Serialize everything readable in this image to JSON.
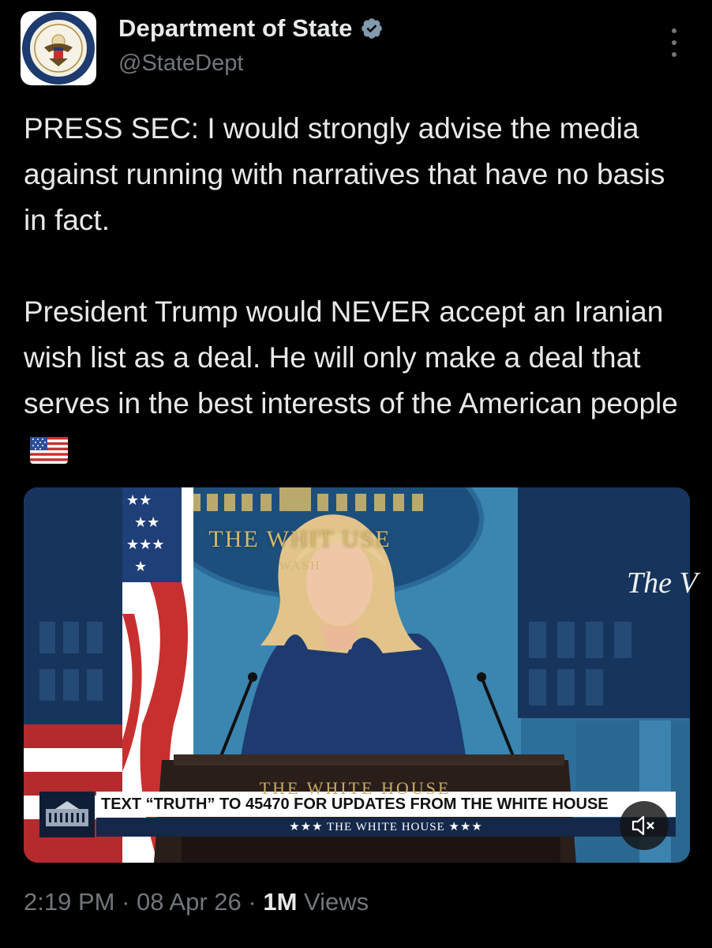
{
  "author": {
    "display_name": "Department of State",
    "handle": "@StateDept",
    "verified": true,
    "avatar_icon": "department-of-state-seal-icon",
    "avatar_text": "DEPARTMENT OF STATE · UNITED STATES OF AMERICA"
  },
  "tweet": {
    "paragraph_1": "PRESS SEC: I would strongly advise the media against running with narratives that have no basis in fact.",
    "paragraph_2": "President Trump would NEVER accept an Iranian wish list as a deal. He will only make a deal that serves in the best interests of the American people",
    "emoji": "us-flag-emoji"
  },
  "media": {
    "type": "video",
    "seal_text": "THE WHIT    USE",
    "seal_subtext": "WASH",
    "screen_text": "The V",
    "podium_text": "THE WHITE HOUSE",
    "chyron_main": "TEXT “TRUTH” TO 45470 FOR UPDATES FROM THE WHITE HOUSE",
    "chyron_sub": "★★★ THE WHITE HOUSE ★★★",
    "mute_icon": "speaker-muted-icon"
  },
  "meta": {
    "time": "2:19 PM",
    "separator": "·",
    "date": "08 Apr 26",
    "views_count": "1M",
    "views_label": "Views"
  },
  "colors": {
    "background": "#000000",
    "text_primary": "#e7e9ea",
    "text_secondary": "#71767b",
    "verified_badge": "#829aab"
  }
}
